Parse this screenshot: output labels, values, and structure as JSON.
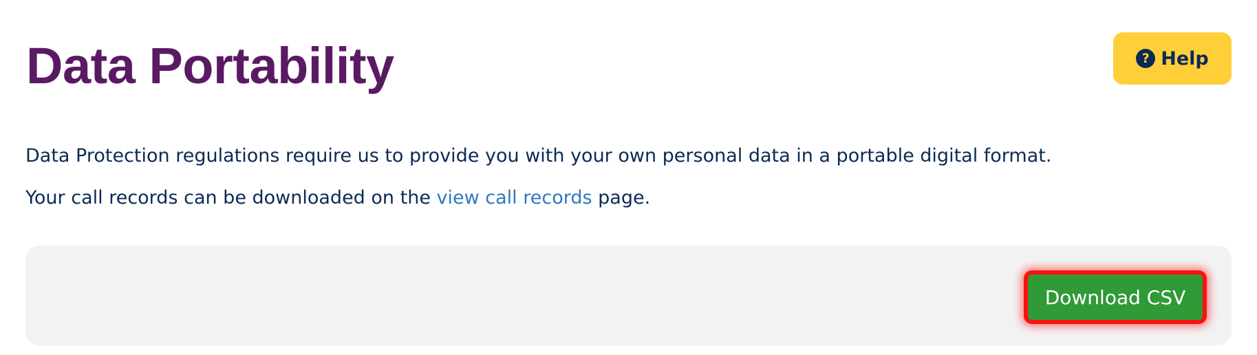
{
  "header": {
    "title": "Data Portability",
    "help_label": "Help",
    "help_icon": "question-circle-icon"
  },
  "content": {
    "paragraph1": "Data Protection regulations require us to provide you with your own personal data in a portable digital format.",
    "paragraph2_before": "Your call records can be downloaded on the ",
    "paragraph2_link": "view call records",
    "paragraph2_after": " page."
  },
  "actions": {
    "download_label": "Download CSV"
  },
  "colors": {
    "title": "#5a1a63",
    "text": "#0b2a55",
    "link": "#2e78c0",
    "help_bg": "#ffcf3a",
    "download_bg": "#2f9a36",
    "highlight_border": "#ff1010",
    "panel_bg": "#f2f2f2"
  }
}
